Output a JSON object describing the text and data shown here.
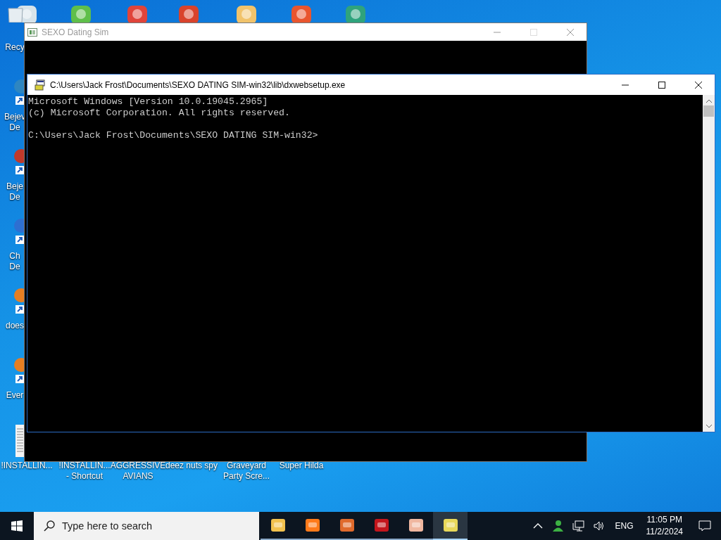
{
  "desktop_icons_left": [
    {
      "lines": [
        "Recy"
      ]
    },
    {
      "lines": [
        "Bejev",
        "De"
      ]
    },
    {
      "lines": [
        "Beje",
        "De"
      ]
    },
    {
      "lines": [
        "Ch",
        "De"
      ]
    },
    {
      "lines": [
        "does"
      ]
    },
    {
      "lines": [
        "Ever"
      ]
    }
  ],
  "desktop_icons_bottom": [
    {
      "lines": [
        "!INSTALLIN..."
      ]
    },
    {
      "lines": [
        "!INSTALLIN...",
        "- Shortcut"
      ]
    },
    {
      "lines": [
        "AGGRESSIVE",
        "AVIANS"
      ]
    },
    {
      "lines": [
        "deez nuts spy"
      ]
    },
    {
      "lines": [
        "Graveyard",
        "Party Scre..."
      ]
    },
    {
      "lines": [
        "Super Hilda"
      ]
    }
  ],
  "game_window": {
    "title": "SEXO Dating Sim",
    "active": false
  },
  "console_window": {
    "title": "C:\\Users\\Jack Frost\\Documents\\SEXO DATING SIM-win32\\lib\\dxwebsetup.exe",
    "active": true,
    "banner": [
      "Microsoft Windows [Version 10.0.19045.2965]",
      "(c) Microsoft Corporation. All rights reserved."
    ],
    "prompt": "C:\\Users\\Jack Frost\\Documents\\SEXO DATING SIM-win32>"
  },
  "taskbar": {
    "search": {
      "placeholder": "Type here to search"
    },
    "apps": [
      {
        "running": true,
        "selected": false
      },
      {
        "running": true,
        "selected": false
      },
      {
        "running": true,
        "selected": false
      },
      {
        "running": true,
        "selected": false
      },
      {
        "running": true,
        "selected": false
      },
      {
        "running": true,
        "selected": true
      }
    ],
    "language": "ENG",
    "time": "11:05 PM",
    "date": "11/2/2024"
  }
}
